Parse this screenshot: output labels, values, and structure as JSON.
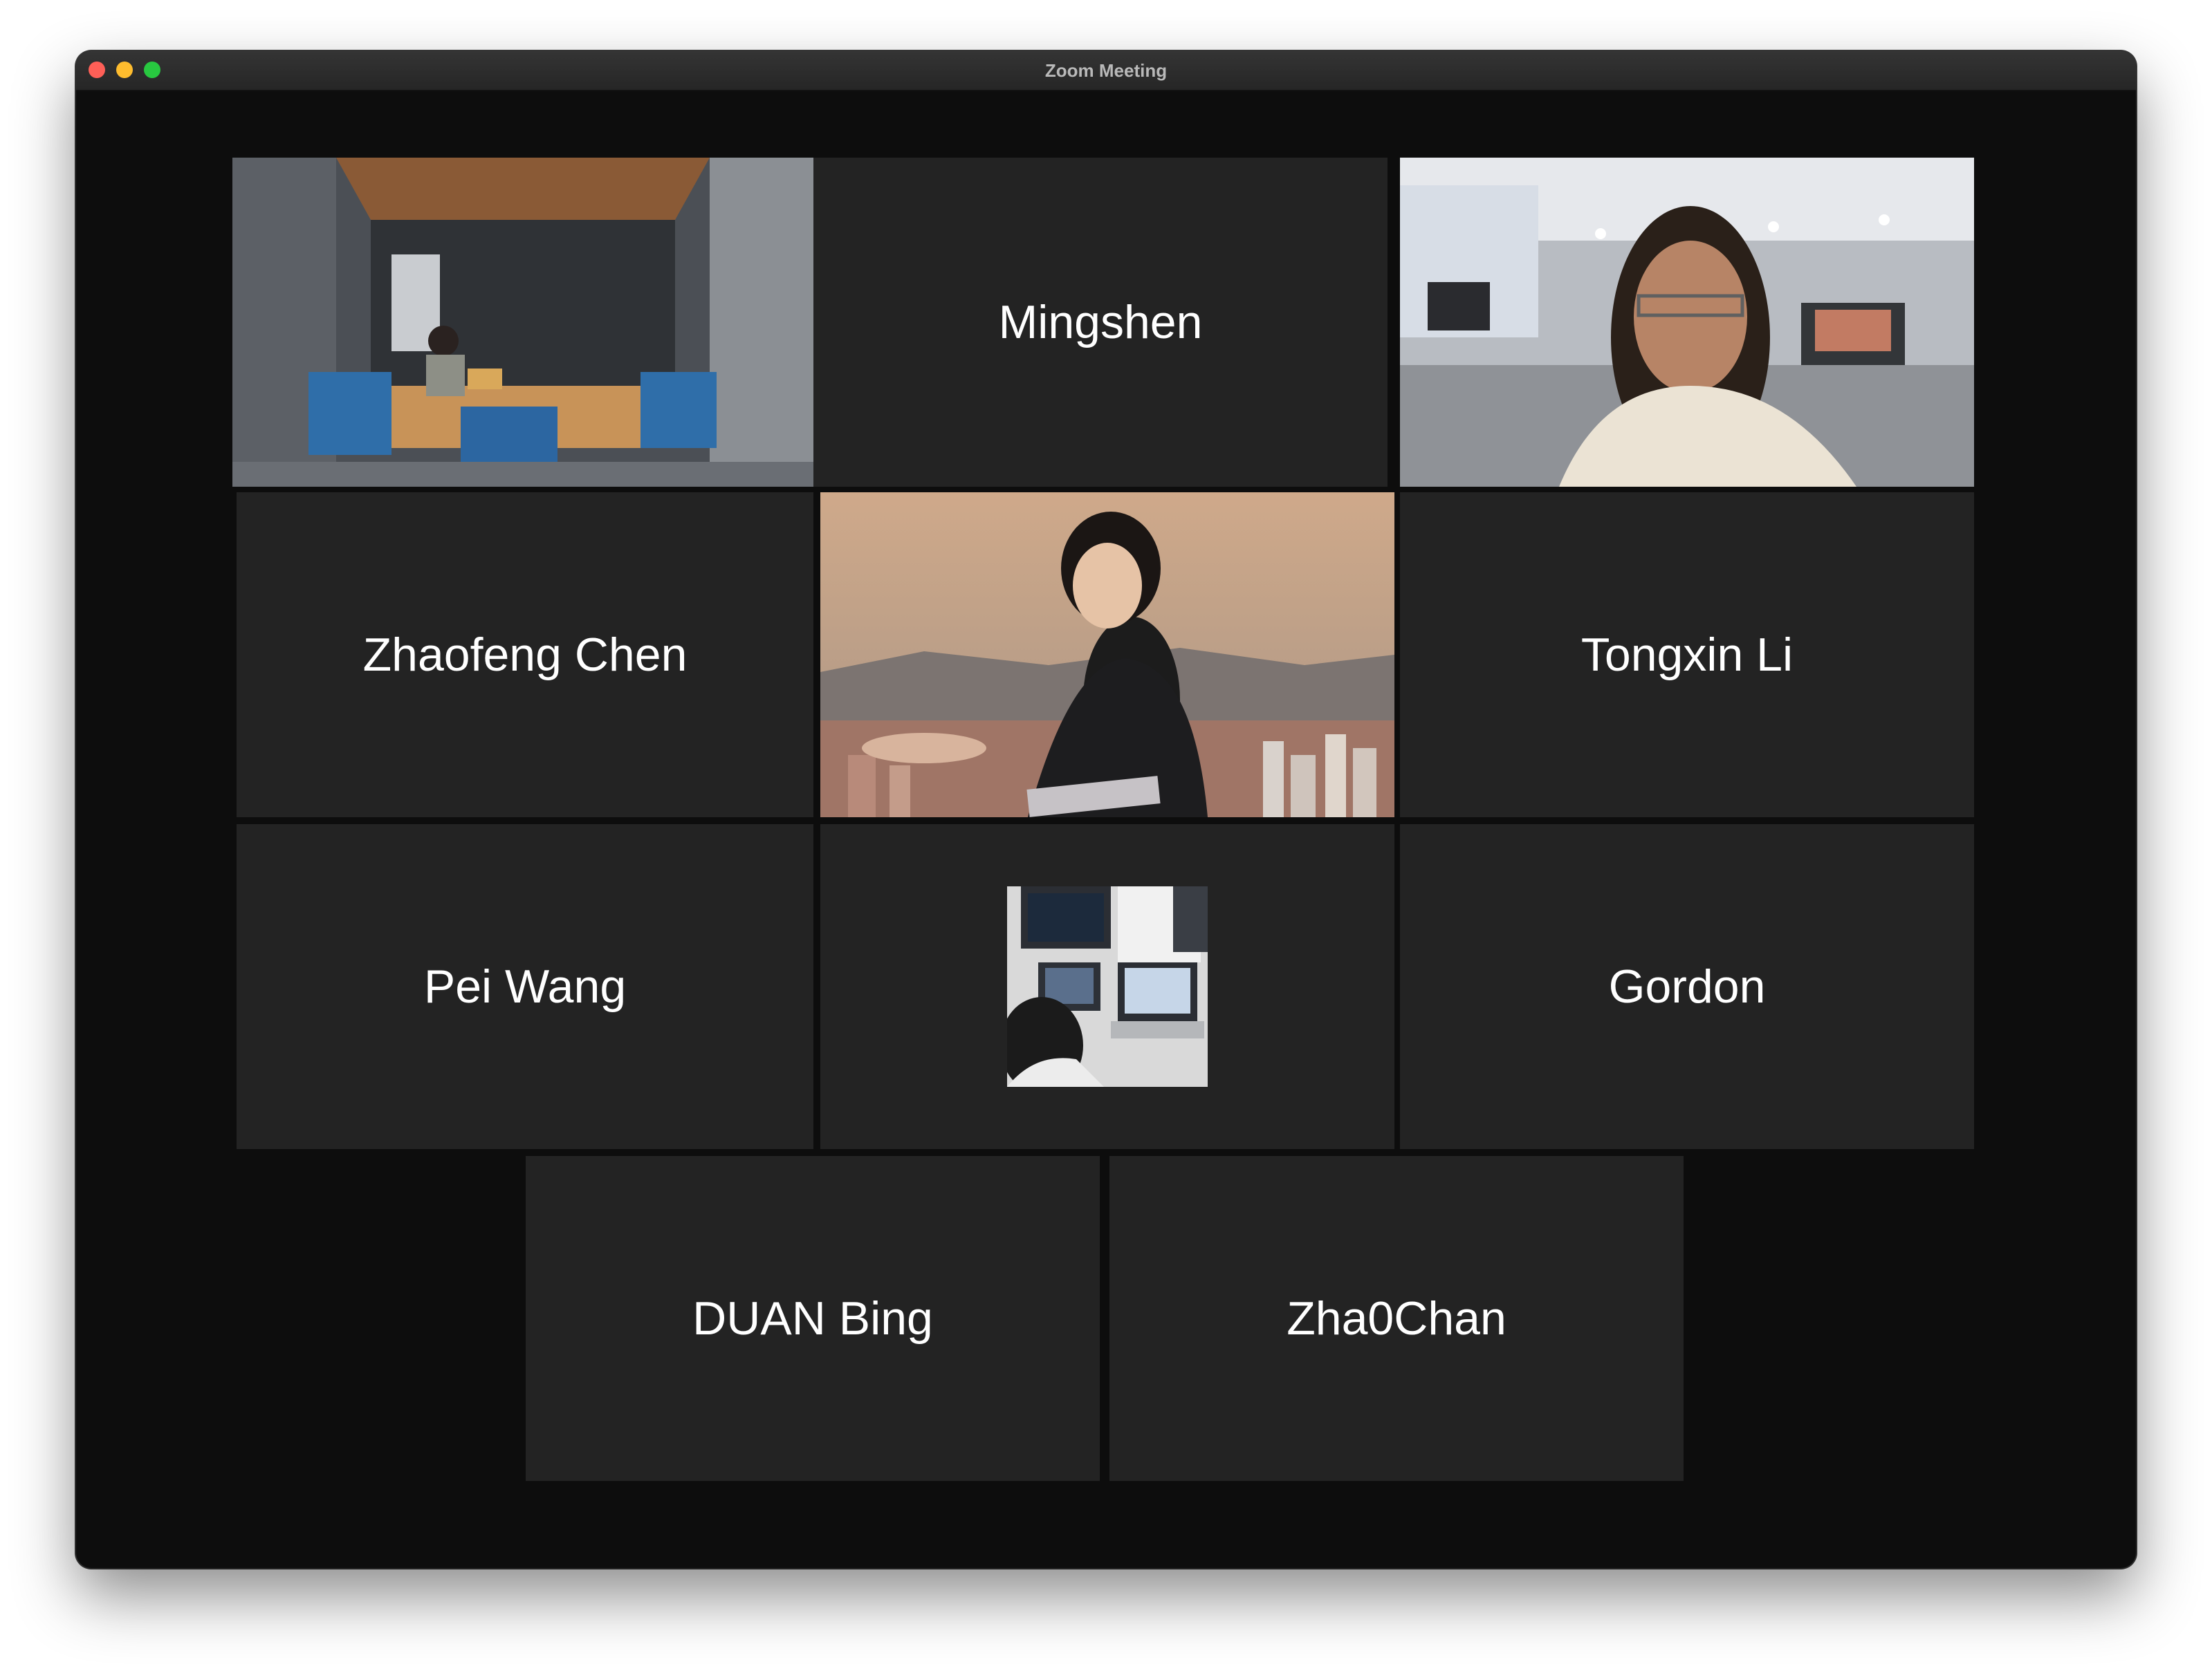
{
  "window": {
    "title": "Zoom Meeting"
  },
  "participants": [
    {
      "name": "",
      "view": "video",
      "active_speaker": true
    },
    {
      "name": "Mingshen",
      "view": "name"
    },
    {
      "name": "",
      "view": "video"
    },
    {
      "name": "Zhaofeng Chen",
      "view": "name"
    },
    {
      "name": "",
      "view": "video"
    },
    {
      "name": "Tongxin Li",
      "view": "name"
    },
    {
      "name": "Pei Wang",
      "view": "name"
    },
    {
      "name": "",
      "view": "profile-picture"
    },
    {
      "name": "Gordon",
      "view": "name"
    },
    {
      "name": "DUAN Bing",
      "view": "name"
    },
    {
      "name": "Zha0Chan",
      "view": "name"
    }
  ],
  "colors": {
    "background": "#0d0d0d",
    "tile": "#232323",
    "active_speaker_border": "#d8e26e"
  }
}
